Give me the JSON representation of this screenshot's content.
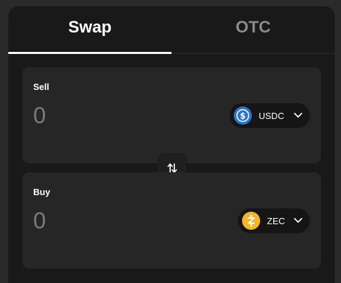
{
  "tabs": {
    "swap_label": "Swap",
    "otc_label": "OTC",
    "active": "Swap"
  },
  "sell": {
    "label": "Sell",
    "amount_placeholder": "0",
    "token": {
      "symbol": "USDC",
      "icon": "usdc-icon",
      "color": "#2775ca"
    }
  },
  "buy": {
    "label": "Buy",
    "amount_placeholder": "0",
    "token": {
      "symbol": "ZEC",
      "icon": "zec-icon",
      "color": "#f4b728"
    }
  },
  "switch_icon": "swap-arrows-icon"
}
